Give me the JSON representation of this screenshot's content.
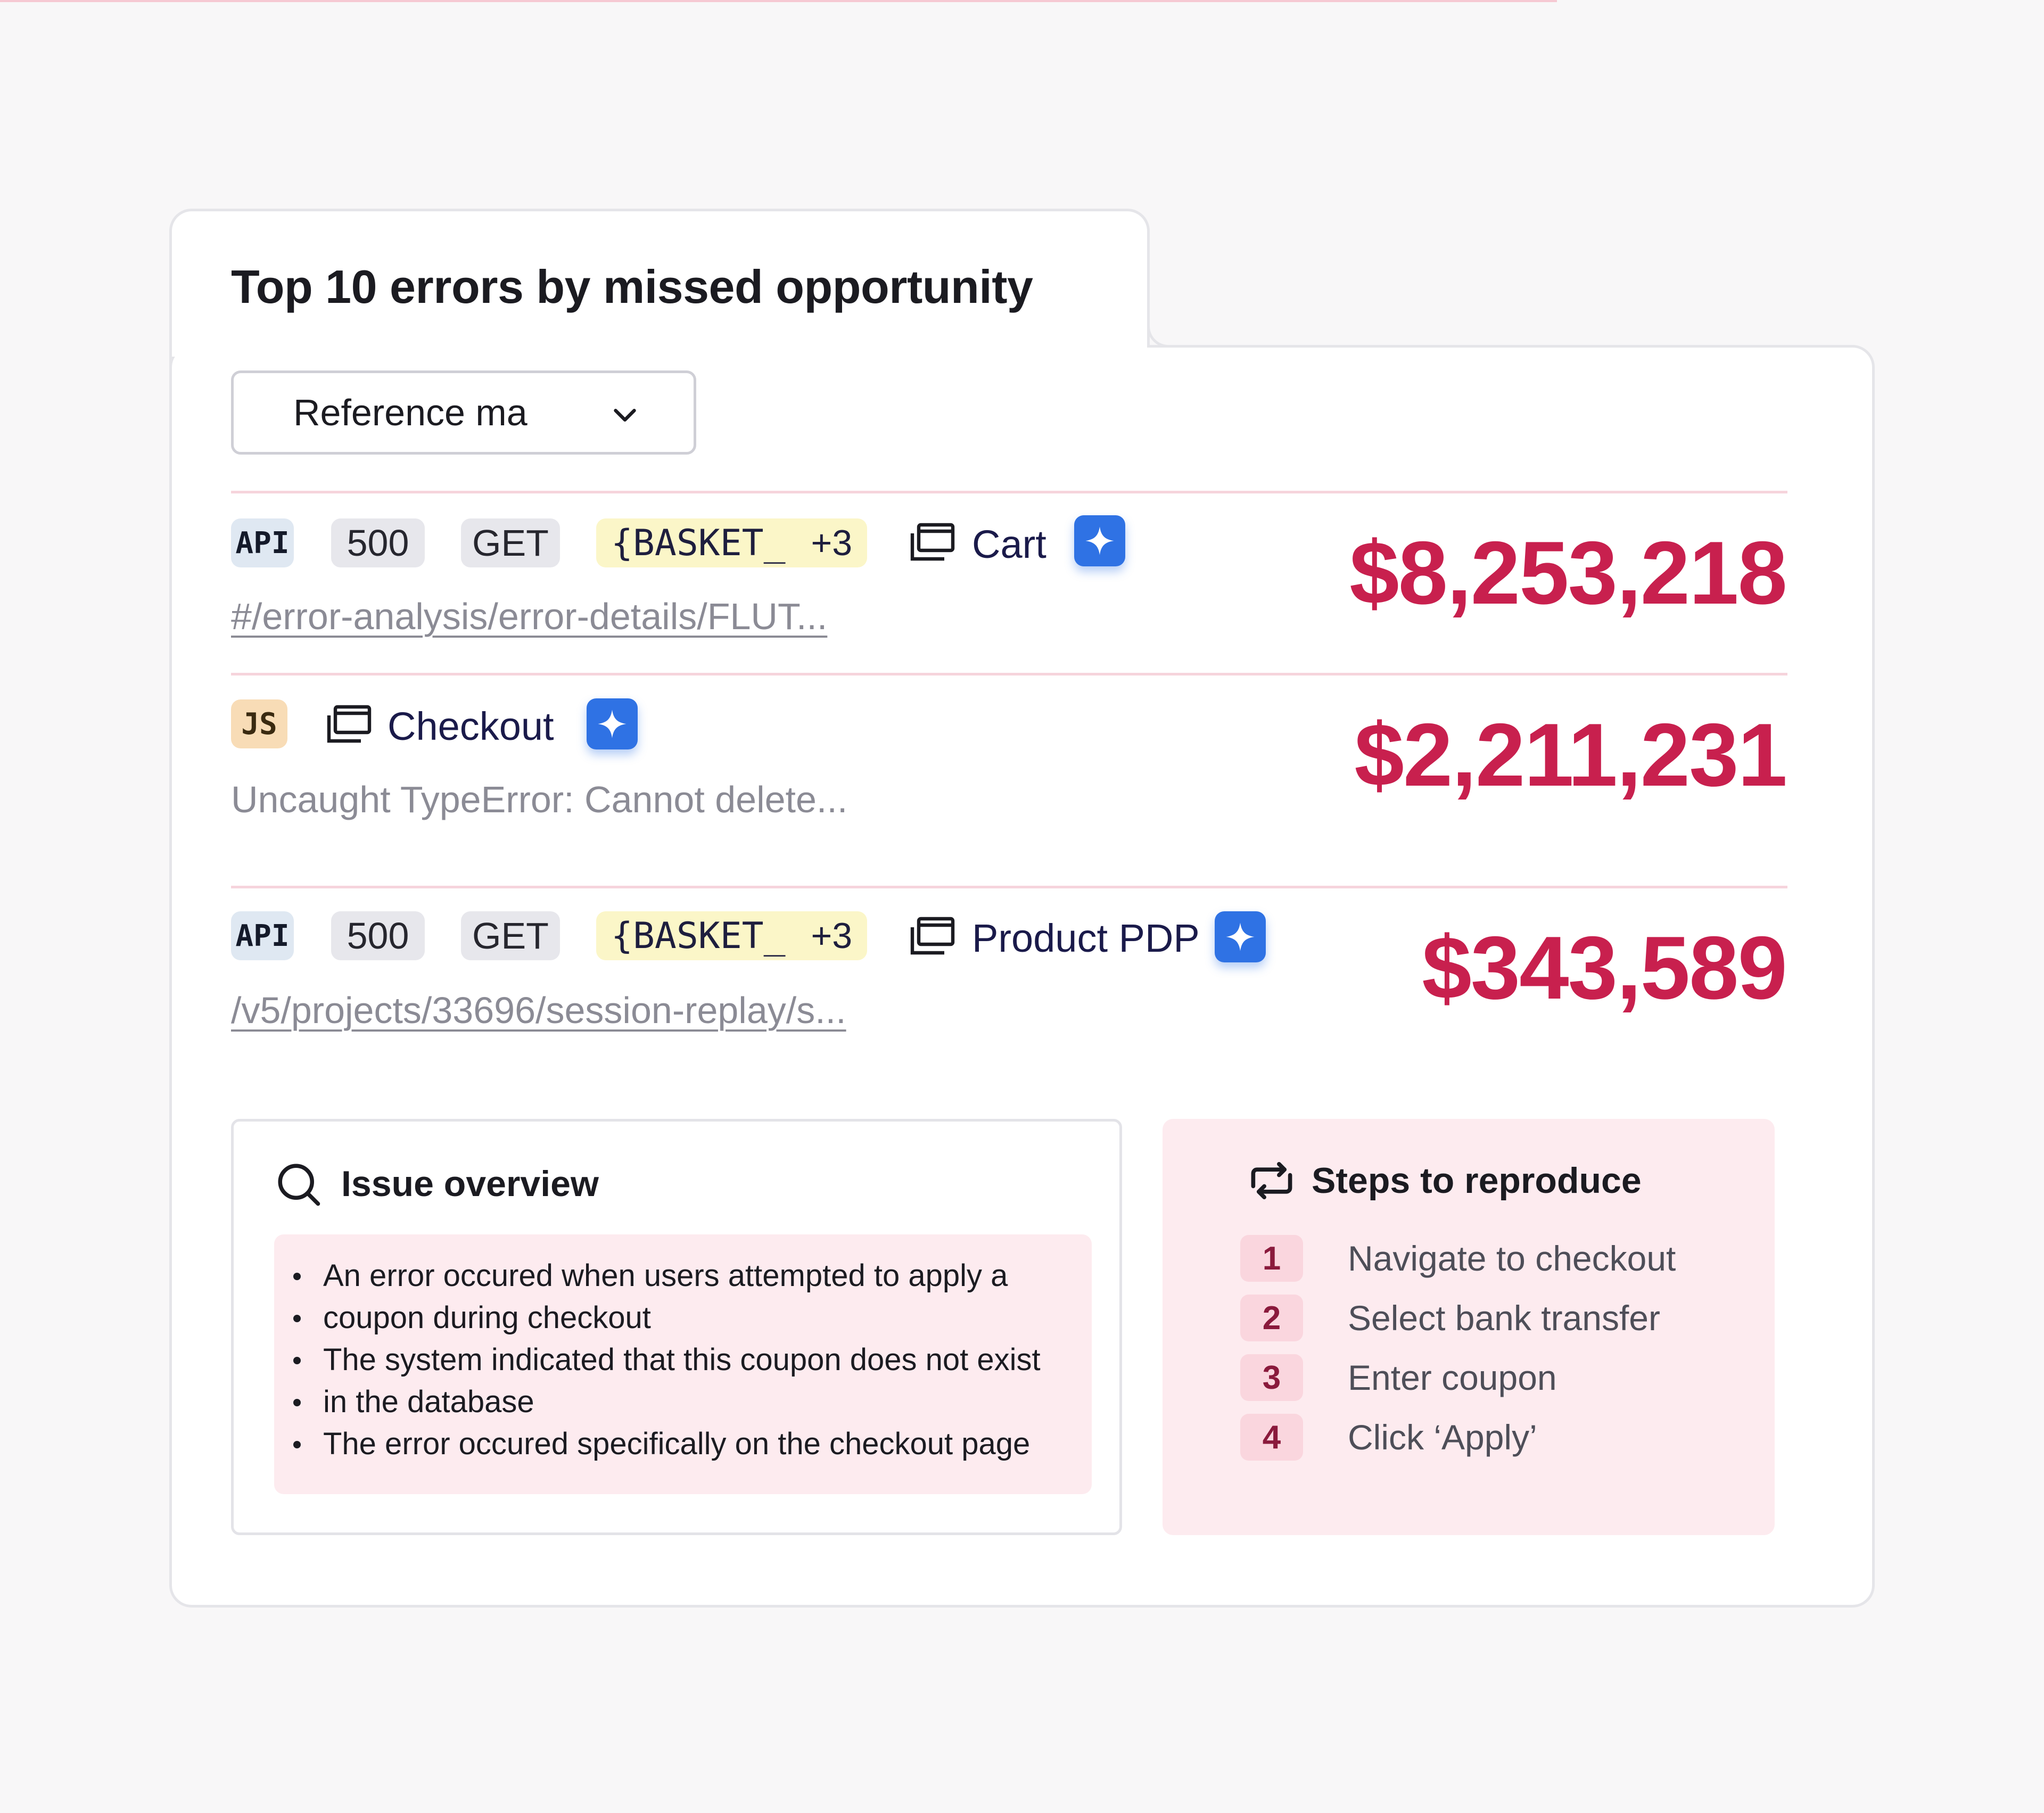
{
  "widget": {
    "title": "Top 10 errors by missed opportunity",
    "dropdown": {
      "selected": "Reference ma",
      "icon": "chevron-down-icon"
    }
  },
  "errors": [
    {
      "type_badge": "API",
      "status": "500",
      "method": "GET",
      "tag": "{BASKET_",
      "tag_more": "+3",
      "page": "Cart",
      "page_icon": "page-window-icon",
      "ai_icon": "sparkle-icon",
      "detail": "#/error-analysis/error-details/FLUT...",
      "amount": "$8,253,218"
    },
    {
      "type_badge": "JS",
      "page": "Checkout",
      "page_icon": "page-window-icon",
      "ai_icon": "sparkle-icon",
      "detail": "Uncaught TypeError: Cannot delete...",
      "amount": "$2,211,231"
    },
    {
      "type_badge": "API",
      "status": "500",
      "method": "GET",
      "tag": "{BASKET_",
      "tag_more": "+3",
      "page": "Product PDP",
      "page_icon": "page-window-icon",
      "ai_icon": "sparkle-icon",
      "detail": "/v5/projects/33696/session-replay/s...",
      "amount": "$343,589"
    }
  ],
  "issue_overview": {
    "title": "Issue overview",
    "icon": "search-icon",
    "bullets": [
      "An error occured when users attempted to apply a",
      "coupon during checkout",
      "The system indicated that this coupon does not exist",
      "in the database",
      "The error occured specifically on the checkout page"
    ]
  },
  "steps": {
    "title": "Steps to reproduce",
    "icon": "repeat-icon",
    "items": [
      {
        "num": "1",
        "text": "Navigate to checkout"
      },
      {
        "num": "2",
        "text": "Select bank transfer"
      },
      {
        "num": "3",
        "text": "Enter coupon"
      },
      {
        "num": "4",
        "text": "Click ‘Apply’"
      }
    ]
  },
  "colors": {
    "amount": "#c8204e",
    "ai_button": "#2f72e4",
    "api_badge": "#dfe8f2",
    "js_badge": "#f8dcb6",
    "tag_bg": "#fbf6c8",
    "pink_panel": "#fdebef"
  }
}
